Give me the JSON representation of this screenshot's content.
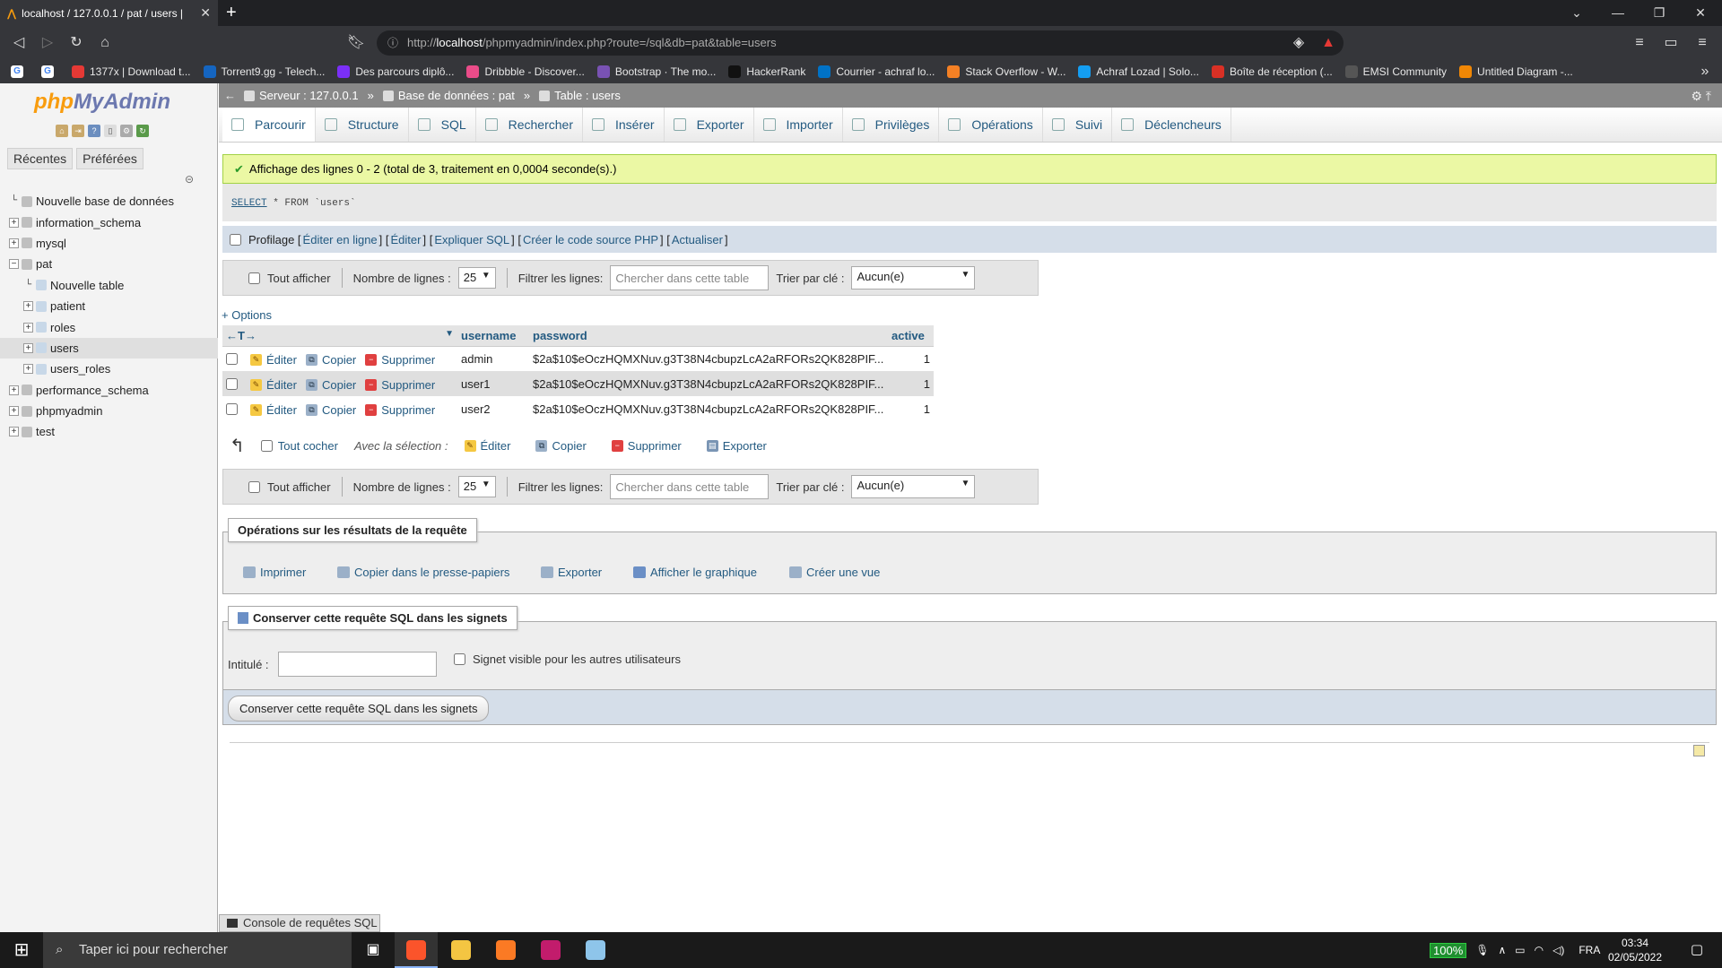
{
  "browser": {
    "tab_title": "localhost / 127.0.0.1 / pat / users |",
    "url_prefix": "http://",
    "url_host": "localhost",
    "url_path": "/phpmyadmin/index.php?route=/sql&db=pat&table=users",
    "bookmarks": [
      {
        "label": "",
        "icon": "google-icon",
        "color": "#ffffff"
      },
      {
        "label": "",
        "icon": "google-icon",
        "color": "#ffffff"
      },
      {
        "label": "1377x | Download t...",
        "icon": "x-icon",
        "color": "#e53935"
      },
      {
        "label": "Torrent9.gg - Telech...",
        "icon": "t-icon",
        "color": "#1565c0"
      },
      {
        "label": "Des parcours diplô...",
        "icon": "openclassrooms-icon",
        "color": "#7b2ff7"
      },
      {
        "label": "Dribbble - Discover...",
        "icon": "dribbble-icon",
        "color": "#ea4c89"
      },
      {
        "label": "Bootstrap · The mo...",
        "icon": "bootstrap-icon",
        "color": "#7952b3"
      },
      {
        "label": "HackerRank",
        "icon": "hackerrank-icon",
        "color": "#111111"
      },
      {
        "label": "Courrier - achraf lo...",
        "icon": "outlook-icon",
        "color": "#0072c6"
      },
      {
        "label": "Stack Overflow - W...",
        "icon": "stackoverflow-icon",
        "color": "#f48024"
      },
      {
        "label": "Achraf Lozad | Solo...",
        "icon": "sololearn-icon",
        "color": "#149ef2"
      },
      {
        "label": "Boîte de réception (...",
        "icon": "gmail-icon",
        "color": "#d93025"
      },
      {
        "label": "EMSI Community",
        "icon": "emsi-icon",
        "color": "#555555"
      },
      {
        "label": "Untitled Diagram -...",
        "icon": "drawio-icon",
        "color": "#f08705"
      }
    ]
  },
  "left": {
    "logo_php": "php",
    "logo_myadmin": "MyAdmin",
    "tab_recent": "Récentes",
    "tab_prefs": "Préférées",
    "tree": [
      {
        "label": "Nouvelle base de données",
        "level": 0,
        "expander": "",
        "selected": false
      },
      {
        "label": "information_schema",
        "level": 0,
        "expander": "+",
        "selected": false
      },
      {
        "label": "mysql",
        "level": 0,
        "expander": "+",
        "selected": false
      },
      {
        "label": "pat",
        "level": 0,
        "expander": "−",
        "selected": false
      },
      {
        "label": "Nouvelle table",
        "level": 1,
        "expander": "",
        "selected": false
      },
      {
        "label": "patient",
        "level": 1,
        "expander": "+",
        "selected": false
      },
      {
        "label": "roles",
        "level": 1,
        "expander": "+",
        "selected": false
      },
      {
        "label": "users",
        "level": 1,
        "expander": "+",
        "selected": true
      },
      {
        "label": "users_roles",
        "level": 1,
        "expander": "+",
        "selected": false
      },
      {
        "label": "performance_schema",
        "level": 0,
        "expander": "+",
        "selected": false
      },
      {
        "label": "phpmyadmin",
        "level": 0,
        "expander": "+",
        "selected": false
      },
      {
        "label": "test",
        "level": 0,
        "expander": "+",
        "selected": false
      }
    ]
  },
  "breadcrumb": {
    "server": "Serveur : 127.0.0.1",
    "database": "Base de données : pat",
    "table": "Table : users"
  },
  "menu": [
    {
      "label": "Parcourir",
      "icon": "browse-icon",
      "active": true
    },
    {
      "label": "Structure",
      "icon": "structure-icon",
      "active": false
    },
    {
      "label": "SQL",
      "icon": "sql-icon",
      "active": false
    },
    {
      "label": "Rechercher",
      "icon": "search-icon",
      "active": false
    },
    {
      "label": "Insérer",
      "icon": "insert-icon",
      "active": false
    },
    {
      "label": "Exporter",
      "icon": "export-icon",
      "active": false
    },
    {
      "label": "Importer",
      "icon": "import-icon",
      "active": false
    },
    {
      "label": "Privilèges",
      "icon": "privileges-icon",
      "active": false
    },
    {
      "label": "Opérations",
      "icon": "operations-icon",
      "active": false
    },
    {
      "label": "Suivi",
      "icon": "tracking-icon",
      "active": false
    },
    {
      "label": "Déclencheurs",
      "icon": "triggers-icon",
      "active": false
    }
  ],
  "success_message": "Affichage des lignes 0 - 2 (total de 3, traitement en 0,0004 seconde(s).)",
  "sql": {
    "kw": "SELECT",
    "rest": " * FROM `users`"
  },
  "profiling": {
    "label": "Profilage",
    "links": [
      "Éditer en ligne",
      "Éditer",
      "Expliquer SQL",
      "Créer le code source PHP",
      "Actualiser"
    ]
  },
  "nav": {
    "show_all": "Tout afficher",
    "rows_label": "Nombre de lignes :",
    "rows_value": "25",
    "filter_label": "Filtrer les lignes:",
    "filter_placeholder": "Chercher dans cette table",
    "sort_label": "Trier par clé :",
    "sort_value": "Aucun(e)"
  },
  "options_link": "+ Options",
  "table": {
    "columns": [
      "username",
      "password",
      "active"
    ],
    "action_labels": {
      "edit": "Éditer",
      "copy": "Copier",
      "delete": "Supprimer"
    },
    "rows": [
      {
        "username": "admin",
        "password": "$2a$10$eOczHQMXNuv.g3T38N4cbupzLcA2aRFORs2QK828PIF...",
        "active": "1"
      },
      {
        "username": "user1",
        "password": "$2a$10$eOczHQMXNuv.g3T38N4cbupzLcA2aRFORs2QK828PIF...",
        "active": "1"
      },
      {
        "username": "user2",
        "password": "$2a$10$eOczHQMXNuv.g3T38N4cbupzLcA2aRFORs2QK828PIF...",
        "active": "1"
      }
    ]
  },
  "bulk": {
    "check_all": "Tout cocher",
    "with_selection": "Avec la sélection :",
    "edit": "Éditer",
    "copy": "Copier",
    "delete": "Supprimer",
    "export": "Exporter"
  },
  "query_ops": {
    "legend": "Opérations sur les résultats de la requête",
    "print": "Imprimer",
    "copy_clipboard": "Copier dans le presse-papiers",
    "export": "Exporter",
    "chart": "Afficher le graphique",
    "create_view": "Créer une vue"
  },
  "bookmark_form": {
    "legend": "Conserver cette requête SQL dans les signets",
    "label_field": "Intitulé :",
    "visible_label": "Signet visible pour les autres utilisateurs",
    "submit": "Conserver cette requête SQL dans les signets"
  },
  "console": "Console de requêtes SQL",
  "taskbar": {
    "search_placeholder": "Taper ici pour rechercher",
    "battery": "100%",
    "lang": "FRA",
    "time": "03:34",
    "date": "02/05/2022"
  }
}
